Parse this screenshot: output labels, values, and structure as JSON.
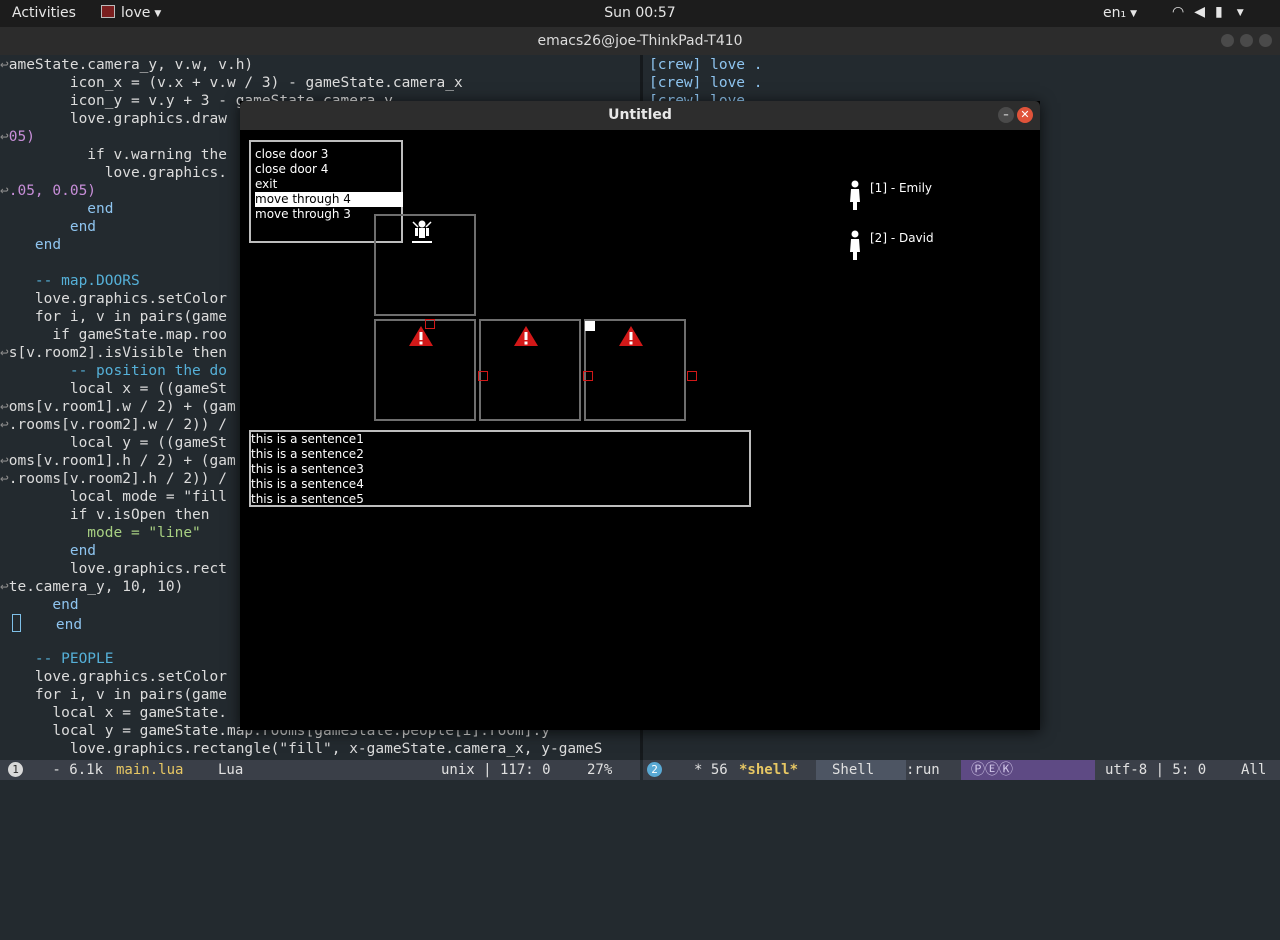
{
  "topbar": {
    "activities": "Activities",
    "app_name": "love",
    "clock": "Sun 00:57",
    "lang": "en₁"
  },
  "emacs": {
    "title": "emacs26@joe-ThinkPad-T410",
    "code_lines": [
      "ameState.camera_y, v.w, v.h)",
      "        icon_x = (v.x + v.w / 3) - gameState.camera_x",
      "        icon_y = v.y + 3 - gameState.camera_y",
      "        love.graphics.draw",
      "05)",
      "          if v.warning the",
      "            love.graphics.",
      ".05, 0.05)",
      "          end",
      "        end",
      "    end",
      "",
      "    -- map.DOORS",
      "    love.graphics.setColor",
      "    for i, v in pairs(game",
      "      if gameState.map.roo",
      "s[v.room2].isVisible then",
      "        -- position the do",
      "        local x = ((gameSt",
      "oms[v.room1].w / 2) + (gam",
      ".rooms[v.room2].w / 2)) /",
      "        local y = ((gameSt",
      "oms[v.room1].h / 2) + (gam",
      ".rooms[v.room2].h / 2)) /",
      "        local mode = \"fill",
      "        if v.isOpen then",
      "          mode = \"line\"",
      "        end",
      "        love.graphics.rect",
      "te.camera_y, 10, 10)",
      "      end",
      "    end",
      "",
      "    -- PEOPLE",
      "    love.graphics.setColor",
      "    for i, v in pairs(game",
      "      local x = gameState.",
      "      local y = gameState.map.rooms[gameState.people[i].room].y",
      "        love.graphics.rectangle(\"fill\", x-gameState.camera_x, y-gameS"
    ],
    "shell_lines": [
      "[crew] love .",
      "[crew] love .",
      "[crew] love ."
    ],
    "modeline_left": {
      "window_num": "1",
      "size_file": " - 6.1k",
      "file": "main.lua",
      "mode": "Lua",
      "enc": "unix | 117: 0",
      "pct": "27%"
    },
    "modeline_right": {
      "window_num": "2",
      "mod": "* 56",
      "buffer": "*shell*",
      "mode": "Shell",
      "proc": ":run",
      "peek": "ⓅⒺⓀ",
      "enc": "utf-8 | 5: 0",
      "pos": "All"
    }
  },
  "game_window": {
    "title": "Untitled",
    "menu_items": [
      "close door 3",
      "close door 4",
      "exit",
      "move through 4",
      "move through 3"
    ],
    "selected_index": 3,
    "people": [
      {
        "label": "[1] - Emily"
      },
      {
        "label": "[2] - David"
      }
    ],
    "log_lines": [
      "this is a sentence1",
      "this is a sentence2",
      "this is a sentence3",
      "this is a sentence4",
      "this is a sentence5"
    ]
  },
  "colors": {
    "warning_red": "#d21818",
    "room_border": "#6e6e6e",
    "accent_blue": "#59a9d4"
  }
}
